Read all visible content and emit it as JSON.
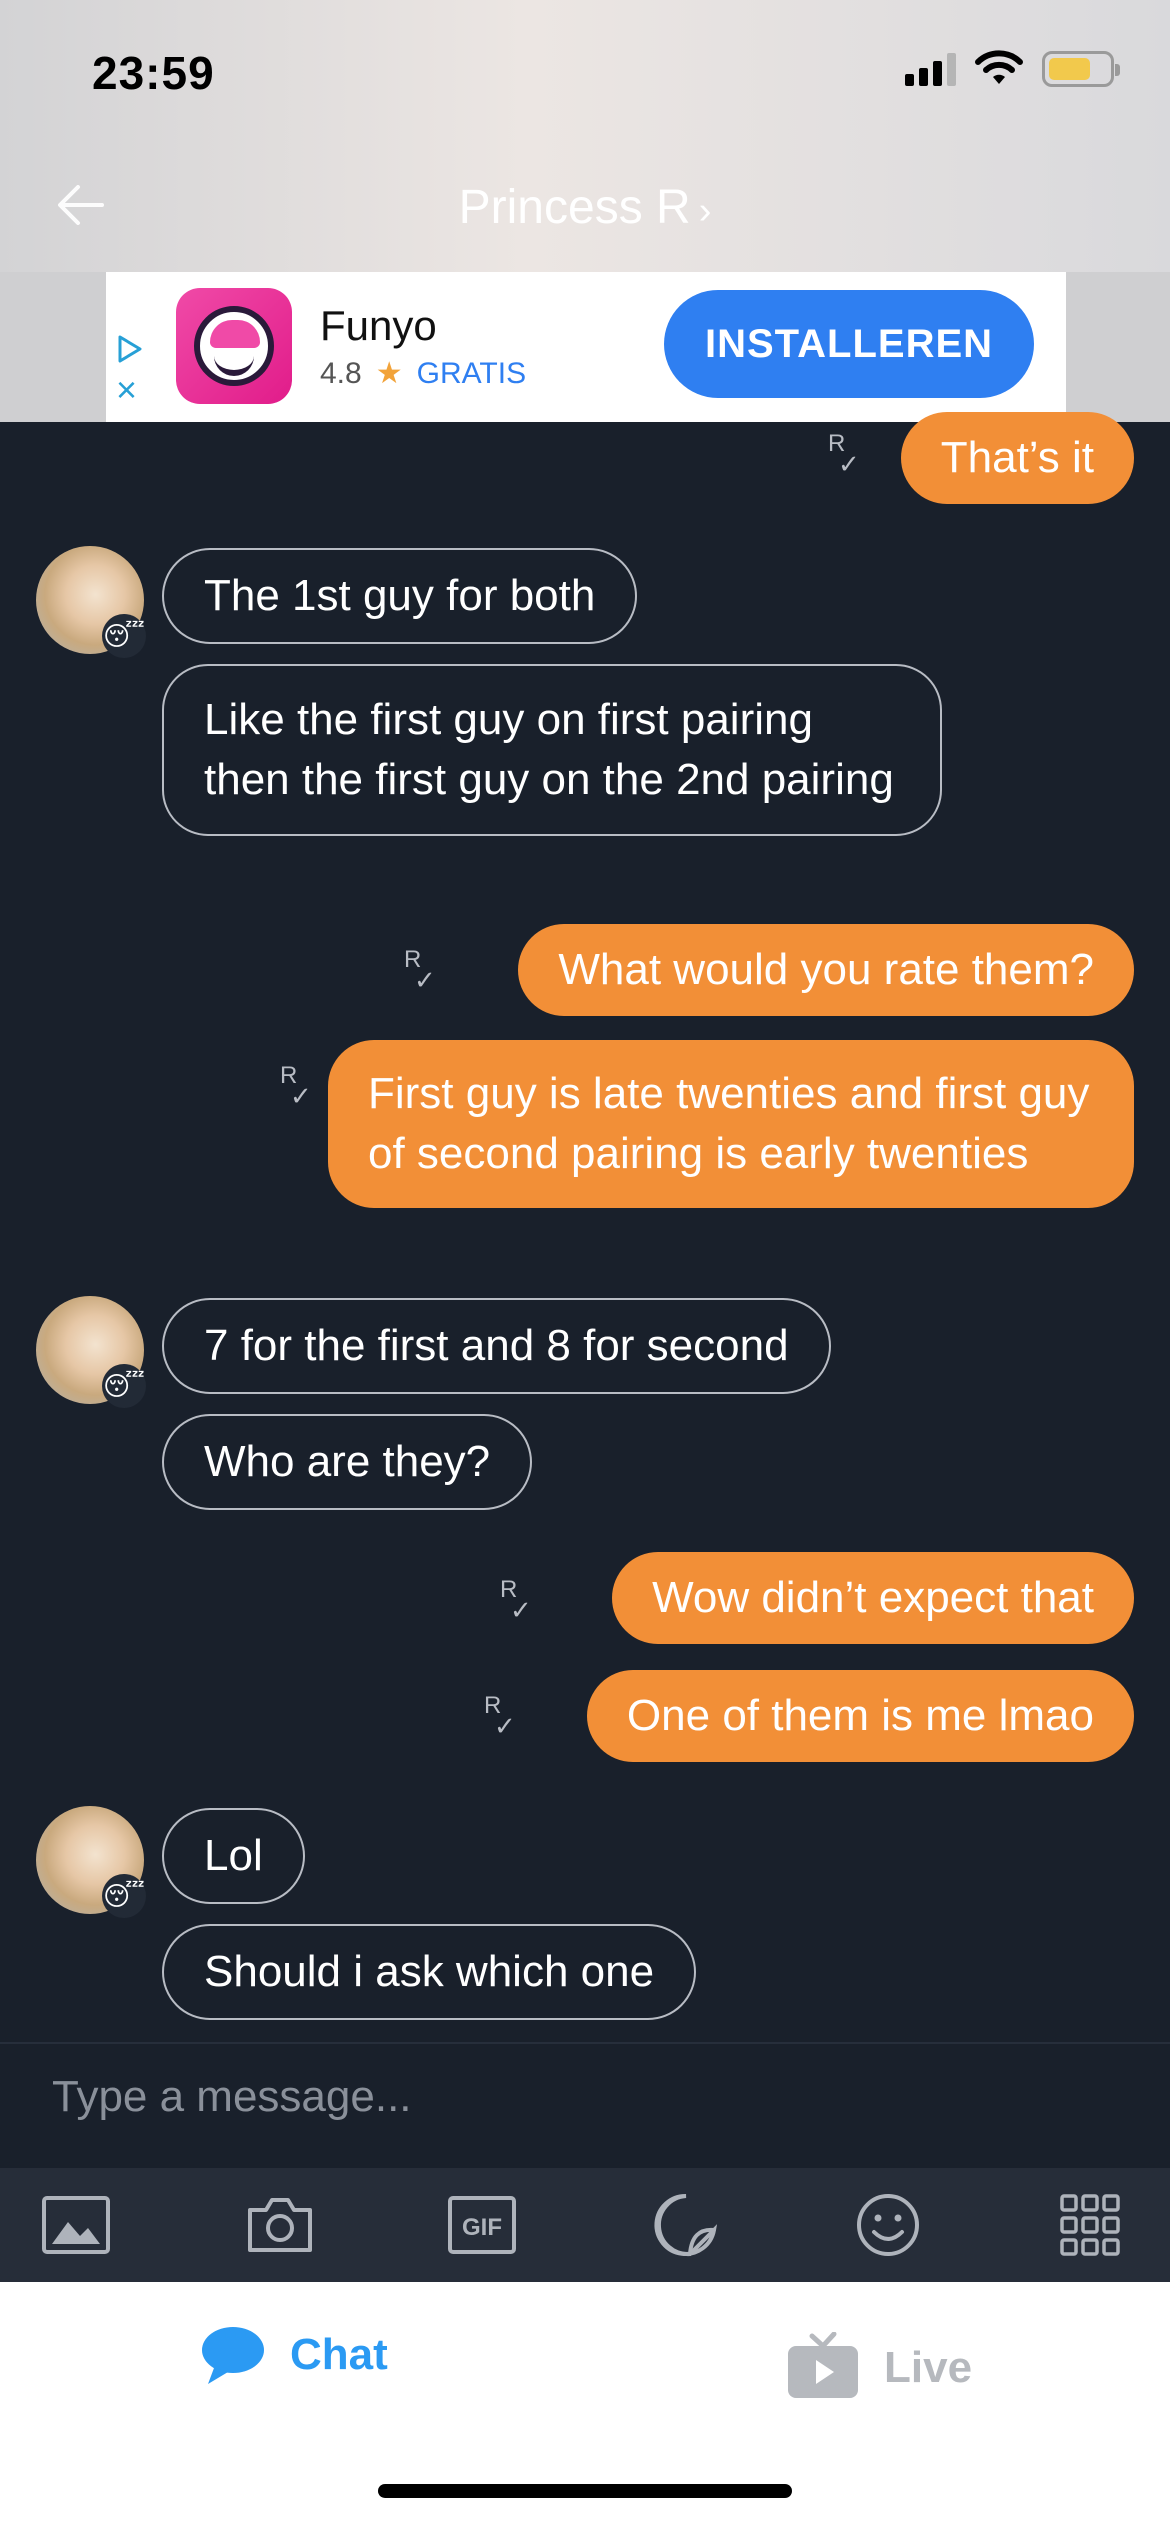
{
  "status_bar": {
    "time": "23:59"
  },
  "header": {
    "back_icon": "back-arrow-icon",
    "contact_name": "Princess R",
    "chevron": "›"
  },
  "ad": {
    "app_name": "Funyo",
    "rating": "4.8",
    "price": "GRATIS",
    "install_label": "INSTALLEREN",
    "adchoices_icon": "play-triangle-icon",
    "close_icon": "×"
  },
  "messages": [
    {
      "side": "out",
      "text": "That’s it"
    },
    {
      "side": "in",
      "text": "The 1st guy for both"
    },
    {
      "side": "in",
      "text": "Like the first guy on first pairing then the first guy on the 2nd pairing"
    },
    {
      "side": "out",
      "text": "What would you rate them?"
    },
    {
      "side": "out",
      "text": "First guy is late twenties and first guy of second pairing is early twenties"
    },
    {
      "side": "in",
      "text": "7 for the first and 8 for second"
    },
    {
      "side": "in",
      "text": "Who are they?"
    },
    {
      "side": "out",
      "text": "Wow didn’t expect that"
    },
    {
      "side": "out",
      "text": "One of them is me lmao"
    },
    {
      "side": "in",
      "text": "Lol"
    },
    {
      "side": "in",
      "text": "Should i ask which one"
    }
  ],
  "receipt": {
    "r": "R",
    "check": "✓"
  },
  "avatar_mood": "😴",
  "composer": {
    "placeholder": "Type a message..."
  },
  "toolbar": {
    "gif_label": "GIF",
    "icons": [
      "image-icon",
      "camera-icon",
      "gif-icon",
      "sticker-icon",
      "emoji-icon",
      "more-grid-icon"
    ]
  },
  "tabs": {
    "chat": "Chat",
    "live": "Live"
  }
}
